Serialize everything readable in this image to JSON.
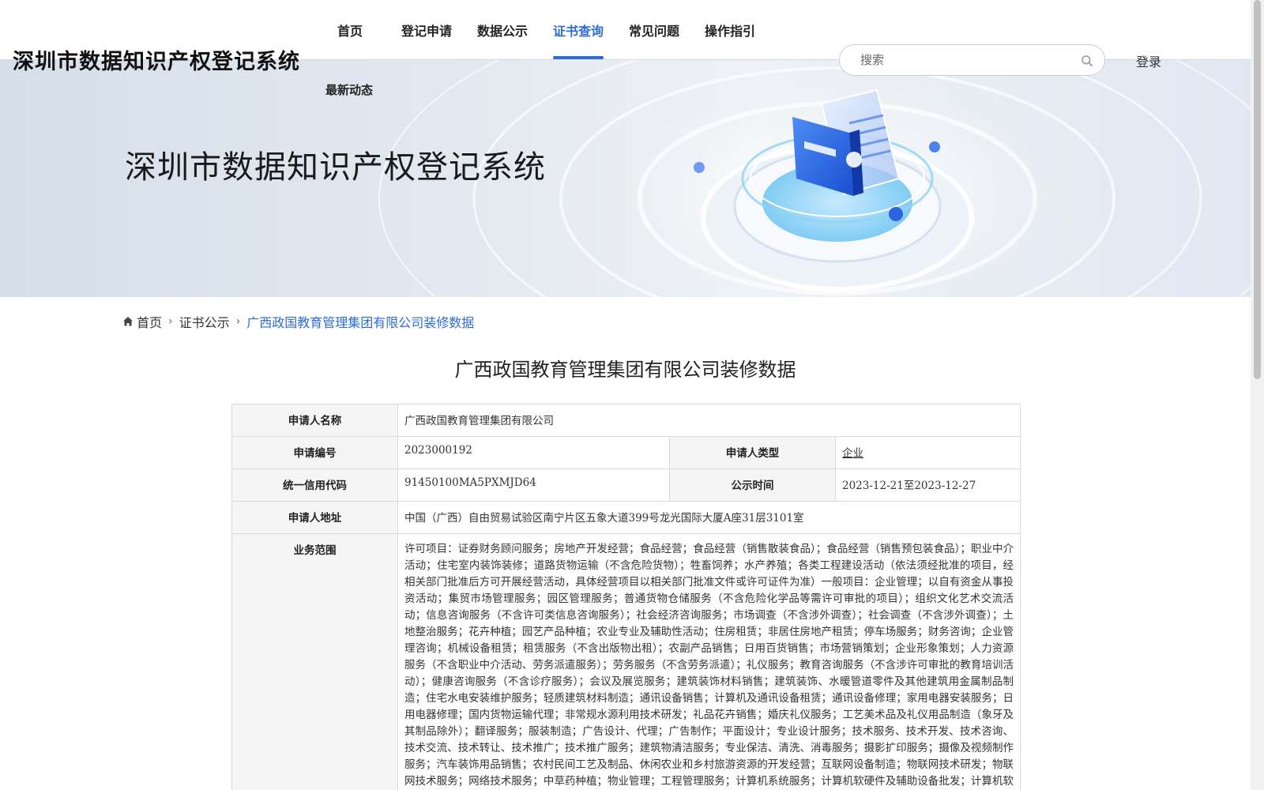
{
  "site": {
    "title": "深圳市数据知识产权登记系统"
  },
  "nav": {
    "items": [
      "首页",
      "登记申请",
      "数据公示",
      "证书查询",
      "常见问题",
      "操作指引"
    ],
    "extra": "最新动态",
    "active": "证书查询"
  },
  "search": {
    "placeholder": "搜索"
  },
  "login": "登录",
  "banner": {
    "title": "深圳市数据知识产权登记系统"
  },
  "breadcrumb": {
    "home": "首页",
    "parent": "证书公示",
    "current": "广西政国教育管理集团有限公司装修数据"
  },
  "page_title": "广西政国教育管理集团有限公司装修数据",
  "details": {
    "applicant_name_label": "申请人名称",
    "applicant_name": "广西政国教育管理集团有限公司",
    "app_no_label": "申请编号",
    "app_no": "2023000192",
    "applicant_type_label": "申请人类型",
    "applicant_type": "企业",
    "credit_code_label": "统一信用代码",
    "credit_code": "91450100MA5PXMJD64",
    "publish_time_label": "公示时间",
    "publish_time": "2023-12-21至2023-12-27",
    "address_label": "申请人地址",
    "address": "中国（广西）自由贸易试验区南宁片区五象大道399号龙光国际大厦A座31层3101室",
    "scope_label": "业务范围",
    "scope": "许可项目：证券财务顾问服务；房地产开发经营；食品经营；食品经营（销售散装食品）；食品经营（销售预包装食品）；职业中介活动；住宅室内装饰装修；道路货物运输（不含危险货物）；牲畜饲养；水产养殖；各类工程建设活动（依法须经批准的项目，经相关部门批准后方可开展经营活动，具体经营项目以相关部门批准文件或许可证件为准）一般项目：企业管理；以自有资金从事投资活动；集贸市场管理服务；园区管理服务；普通货物仓储服务（不含危险化学品等需许可审批的项目）；组织文化艺术交流活动；信息咨询服务（不含许可类信息咨询服务）；社会经济咨询服务；市场调查（不含涉外调查）；社会调查（不含涉外调查）；土地整治服务；花卉种植；园艺产品种植；农业专业及辅助性活动；住房租赁；非居住房地产租赁；停车场服务；财务咨询；企业管理咨询；机械设备租赁；租赁服务（不含出版物出租）；农副产品销售；日用百货销售；市场营销策划；企业形象策划；人力资源服务（不含职业中介活动、劳务派遣服务）；劳务服务（不含劳务派遣）；礼仪服务；教育咨询服务（不含涉许可审批的教育培训活动）；健康咨询服务（不含诊疗服务）；会议及展览服务；建筑装饰材料销售；建筑装饰、水暖管道零件及其他建筑用金属制品制造；住宅水电安装维护服务；轻质建筑材料制造；通讯设备销售；计算机及通讯设备租赁；通讯设备修理；家用电器安装服务；日用电器修理；国内货物运输代理；非常规水源利用技术研发；礼品花卉销售；婚庆礼仪服务；工艺美术品及礼仪用品制造（象牙及其制品除外）；翻译服务；服装制造；广告设计、代理；广告制作；平面设计；专业设计服务；技术服务、技术开发、技术咨询、技术交流、技术转让、技术推广；技术推广服务；建筑物清洁服务；专业保洁、清洗、消毒服务；摄影扩印服务；摄像及视频制作服务；汽车装饰用品销售；农村民间工艺及制品、休闲农业和乡村旅游资源的开发经营；互联网设备制造；物联网技术研发；物联网技术服务；网络技术服务；中草药种植；物业管理；工程管理服务；计算机系统服务；计算机软硬件及辅助设备批发；计算机软硬件及外围设备制造；软件开发；信息技术咨询服务"
  },
  "colors": {
    "accent": "#2d6bd6",
    "label_bg": "#f5f5f5"
  },
  "icons": [
    "search-icon",
    "home-icon",
    "chevron-right-icon",
    "certificate-illustration"
  ]
}
